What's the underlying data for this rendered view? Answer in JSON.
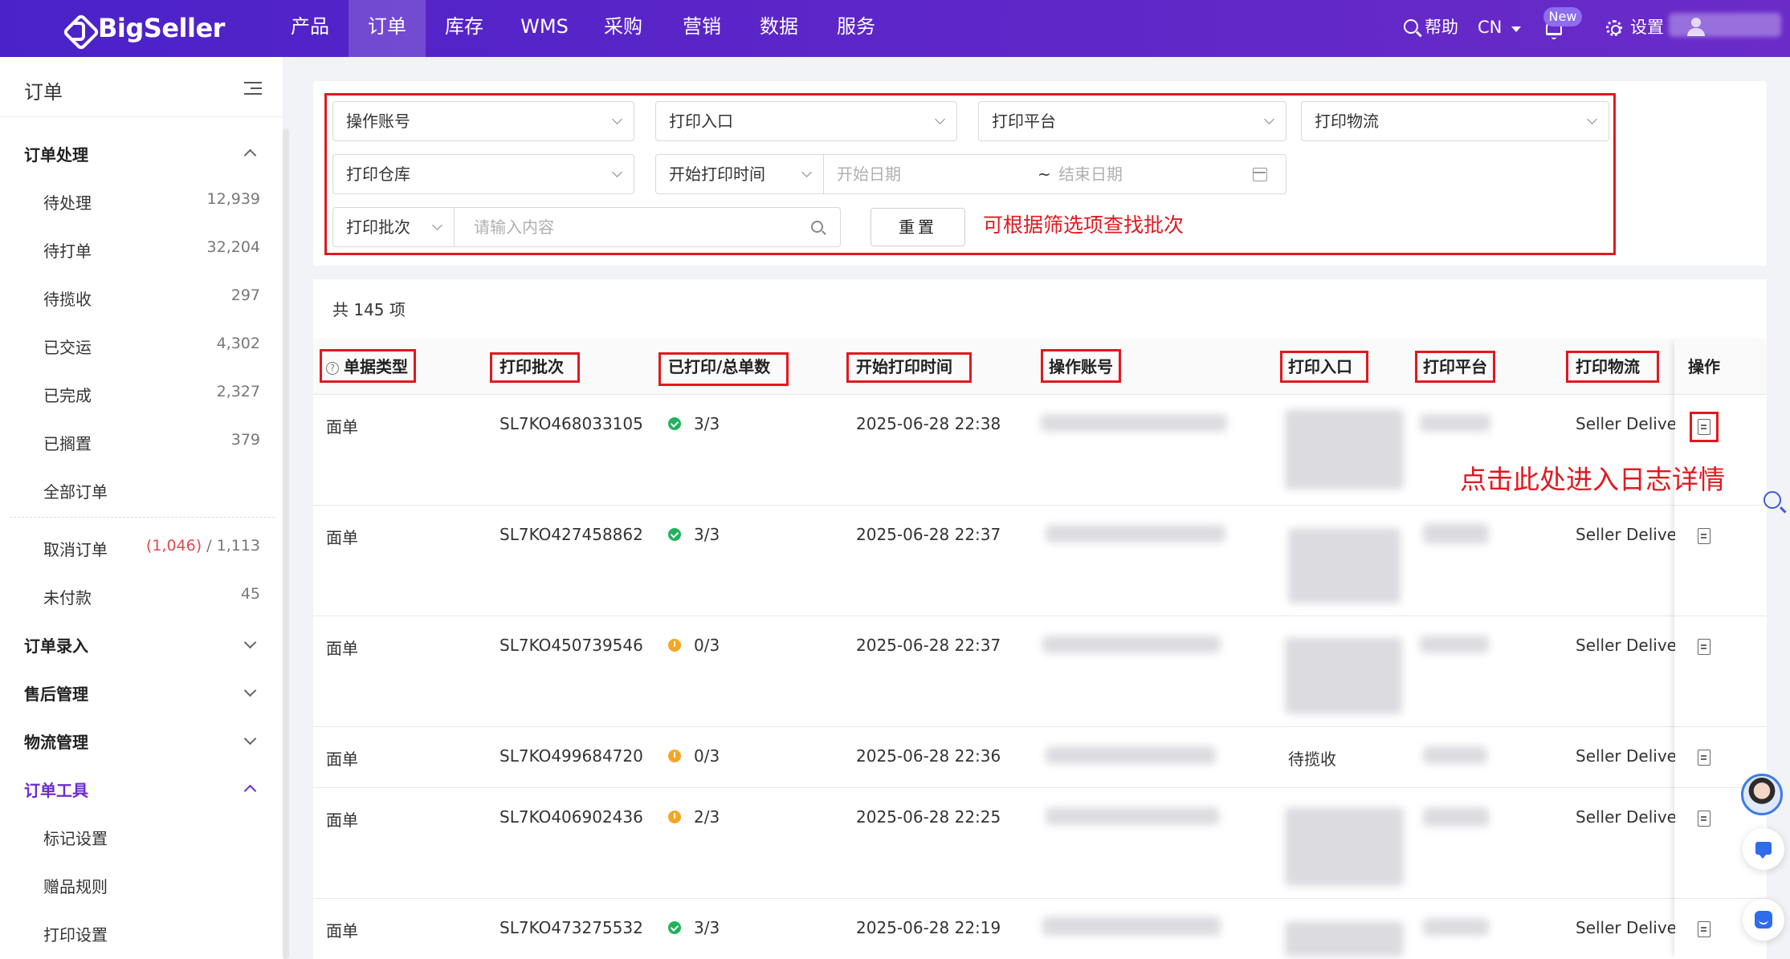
{
  "header": {
    "logo": "BigSeller",
    "nav": [
      "产品",
      "订单",
      "库存",
      "WMS",
      "采购",
      "营销",
      "数据",
      "服务"
    ],
    "active_nav": "订单",
    "help": "帮助",
    "lang": "CN",
    "new_badge": "New",
    "settings": "设置"
  },
  "sidebar": {
    "title": "订单",
    "group_order_processing": "订单处理",
    "items": [
      {
        "label": "待处理",
        "count": "12,939"
      },
      {
        "label": "待打单",
        "count": "32,204"
      },
      {
        "label": "待揽收",
        "count": "297"
      },
      {
        "label": "已交运",
        "count": "4,302"
      },
      {
        "label": "已完成",
        "count": "2,327"
      },
      {
        "label": "已搁置",
        "count": "379"
      },
      {
        "label": "全部订单",
        "count": ""
      }
    ],
    "cancel_label": "取消订单",
    "cancel_count_red": "(1,046)",
    "cancel_count_total": " / 1,113",
    "unpaid_label": "未付款",
    "unpaid_count": "45",
    "group_order_entry": "订单录入",
    "group_after_sales": "售后管理",
    "group_logistics": "物流管理",
    "group_order_tools": "订单工具",
    "tools_items": [
      "标记设置",
      "赠品规则",
      "打印设置"
    ]
  },
  "filters": {
    "account": "操作账号",
    "print_entry": "打印入口",
    "print_platform": "打印平台",
    "print_logistics": "打印物流",
    "print_warehouse": "打印仓库",
    "time_type": "开始打印时间",
    "start_date_placeholder": "开始日期",
    "tilde": "~",
    "end_date_placeholder": "结束日期",
    "batch_type": "打印批次",
    "search_placeholder": "请输入内容",
    "reset": "重置",
    "annotation": "可根据筛选项查找批次"
  },
  "table": {
    "total": "共 145 项",
    "headers": {
      "doc_type": "单据类型",
      "batch": "打印批次",
      "printed_total": "已打印/总单数",
      "start_time": "开始打印时间",
      "account": "操作账号",
      "entry": "打印入口",
      "platform": "打印平台",
      "logistics": "打印物流",
      "action": "操作"
    },
    "rows": [
      {
        "type": "面单",
        "batch": "SL7KO468033105",
        "status": "green",
        "count": "3/3",
        "time": "2025-06-28 22:38",
        "entry": "",
        "logistics": "Seller Delivery"
      },
      {
        "type": "面单",
        "batch": "SL7KO427458862",
        "status": "green",
        "count": "3/3",
        "time": "2025-06-28 22:37",
        "entry": "",
        "logistics": "Seller Delivery"
      },
      {
        "type": "面单",
        "batch": "SL7KO450739546",
        "status": "orange",
        "count": "0/3",
        "time": "2025-06-28 22:37",
        "entry": "",
        "logistics": "Seller Delivery"
      },
      {
        "type": "面单",
        "batch": "SL7KO499684720",
        "status": "orange",
        "count": "0/3",
        "time": "2025-06-28 22:36",
        "entry": "待揽收",
        "logistics": "Seller Delivery"
      },
      {
        "type": "面单",
        "batch": "SL7KO406902436",
        "status": "orange",
        "count": "2/3",
        "time": "2025-06-28 22:25",
        "entry": "",
        "logistics": "Seller Delivery"
      },
      {
        "type": "面单",
        "batch": "SL7KO473275532",
        "status": "green",
        "count": "3/3",
        "time": "2025-06-28 22:19",
        "entry": "",
        "logistics": "Seller Delivery"
      }
    ],
    "log_annotation": "点击此处进入日志详情"
  },
  "colors": {
    "nav_start": "#4b22c9",
    "nav_end": "#6a2bc8",
    "accent": "#6a2bd0",
    "annotation_red": "#e0191f",
    "success": "#1fb35a",
    "warning": "#f5a623"
  }
}
